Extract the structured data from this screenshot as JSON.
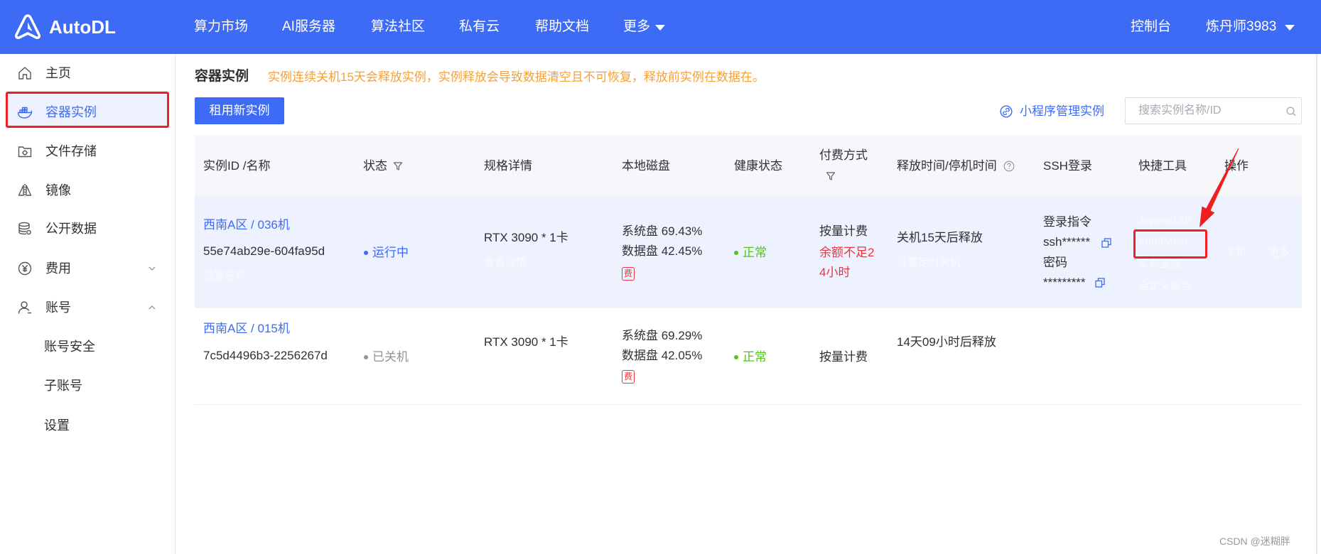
{
  "header": {
    "brand": "AutoDL",
    "nav": [
      {
        "label": "算力市场"
      },
      {
        "label": "AI服务器"
      },
      {
        "label": "算法社区"
      },
      {
        "label": "私有云"
      },
      {
        "label": "帮助文档"
      },
      {
        "label": "更多"
      }
    ],
    "console": "控制台",
    "user": "炼丹师3983"
  },
  "sidebar": {
    "items": [
      {
        "label": "主页",
        "icon": "home-icon"
      },
      {
        "label": "容器实例",
        "icon": "docker-icon",
        "active": true
      },
      {
        "label": "文件存储",
        "icon": "file-storage-icon"
      },
      {
        "label": "镜像",
        "icon": "mirror-image-icon"
      },
      {
        "label": "公开数据",
        "icon": "database-icon"
      },
      {
        "label": "费用",
        "icon": "yen-icon",
        "chevron_icon": "chevron-down-icon"
      },
      {
        "label": "账号",
        "icon": "user-icon",
        "chevron_icon": "chevron-up-icon"
      }
    ],
    "account_sub_items": [
      {
        "label": "账号安全"
      },
      {
        "label": "子账号"
      },
      {
        "label": "设置"
      }
    ]
  },
  "main": {
    "title": "容器实例",
    "notice": "实例连续关机15天会释放实例，实例释放会导致数据清空且不可恢复，释放前实例在数据在。",
    "rent_button": "租用新实例",
    "mini_program_link": "小程序管理实例",
    "search": {
      "placeholder": "搜索实例名称/ID",
      "value": ""
    }
  },
  "table": {
    "headers": [
      {
        "label": "实例ID /名称"
      },
      {
        "label": "状态",
        "icon": "filter-icon"
      },
      {
        "label": "规格详情"
      },
      {
        "label": "本地磁盘"
      },
      {
        "label": "健康状态"
      },
      {
        "label": "付费方式",
        "icon": "filter-icon"
      },
      {
        "label": "释放时间/停机时间",
        "icon": "question-circle-icon"
      },
      {
        "label": "SSH登录"
      },
      {
        "label": "快捷工具"
      },
      {
        "label": "操作"
      }
    ],
    "rows": [
      {
        "name": "西南A区 / 036机",
        "id": "55e74ab29e-604fa95d",
        "set_name": "设置名称",
        "status": "运行中",
        "status_color": "#3d6bf5",
        "spec": "RTX 3090 * 1卡",
        "spec_detail": "查看详情",
        "disk_system": "系统盘 69.43%",
        "disk_data": "数据盘 42.45%",
        "fee_badge": "费",
        "health": "正常",
        "billing": "按量计费",
        "billing_warning": "余额不足24小时",
        "release": "关机15天后释放",
        "release_action": "设置定时关机",
        "ssh_cmd_label": "登录指令",
        "ssh_cmd": "ssh******",
        "ssh_pwd_label": "密码",
        "ssh_pwd": "*********",
        "tools": [
          "JupyterLab",
          "AutoPanel",
          "实例监控",
          "自定义服务"
        ],
        "actions": [
          "关机",
          "更多"
        ]
      },
      {
        "name": "西南A区 / 015机",
        "id": "7c5d4496b3-2256267d",
        "status": "已关机",
        "status_color": "#909399",
        "spec": "RTX 3090 * 1卡",
        "disk_system": "系统盘 69.29%",
        "disk_data": "数据盘 42.05%",
        "fee_badge": "费",
        "health": "正常",
        "billing": "按量计费",
        "release": "14天09小时后释放"
      }
    ]
  },
  "watermark": "CSDN @迷糊胖",
  "colors": {
    "brand": "#3d6bf5",
    "notice": "#f7a034",
    "danger": "#f0323c",
    "success": "#52c41a",
    "annotation": "#f01e1e",
    "row_active": "#edf2fe"
  }
}
